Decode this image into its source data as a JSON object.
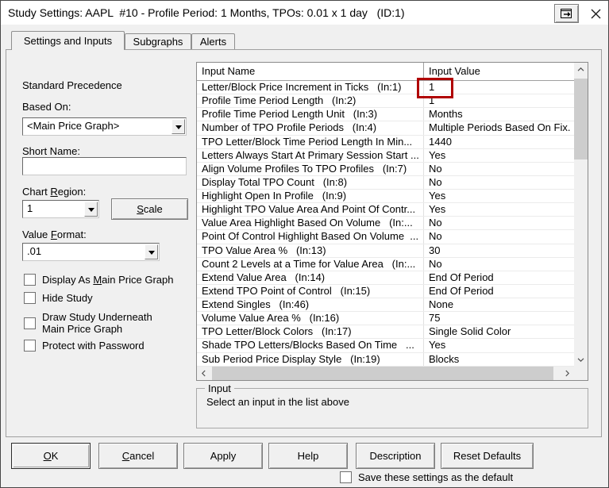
{
  "window": {
    "title": "Study Settings: AAPL  #10 - Profile Period: 1 Months, TPOs: 0.01 x 1 day   (ID:1)"
  },
  "tabs": [
    {
      "label": "Settings and Inputs",
      "active": true
    },
    {
      "label": "Subgraphs",
      "active": false
    },
    {
      "label": "Alerts",
      "active": false
    }
  ],
  "left_panel": {
    "precedence_text": "Standard Precedence",
    "based_on_label": "Based On:",
    "based_on_value": "<Main Price Graph>",
    "short_name_label": "Short Name:",
    "short_name_value": "",
    "chart_region_label": {
      "pre": "Chart ",
      "u": "R",
      "post": "egion:"
    },
    "chart_region_value": "1",
    "scale_button": {
      "pre": "",
      "u": "S",
      "post": "cale"
    },
    "value_format_label": {
      "pre": "Value ",
      "u": "F",
      "post": "ormat:"
    },
    "value_format_value": ".01",
    "checkboxes": [
      {
        "pre": "Display As ",
        "u": "M",
        "post": "ain Price Graph",
        "checked": false
      },
      {
        "pre": "Hide Study",
        "u": "",
        "post": "",
        "checked": false
      },
      {
        "pre": "Draw Study Underneath\nMain Price Graph",
        "u": "",
        "post": "",
        "checked": false
      },
      {
        "pre": "Protect with Password",
        "u": "",
        "post": "",
        "checked": false
      }
    ]
  },
  "inputs_table": {
    "columns": [
      "Input Name",
      "Input Value"
    ],
    "rows": [
      {
        "name": "Letter/Block Price Increment in Ticks   (In:1)",
        "value": "1"
      },
      {
        "name": "Profile Time Period Length   (In:2)",
        "value": "1"
      },
      {
        "name": "Profile Time Period Length Unit   (In:3)",
        "value": "Months"
      },
      {
        "name": "Number of TPO Profile Periods   (In:4)",
        "value": "Multiple Periods Based On Fix."
      },
      {
        "name": "TPO Letter/Block Time Period Length In Min...",
        "value": "1440"
      },
      {
        "name": "Letters Always Start At Primary Session Start ...",
        "value": "Yes"
      },
      {
        "name": "Align Volume Profiles To TPO Profiles   (In:7)",
        "value": "No"
      },
      {
        "name": "Display Total TPO Count   (In:8)",
        "value": "No"
      },
      {
        "name": "Highlight Open In Profile   (In:9)",
        "value": "Yes"
      },
      {
        "name": "Highlight TPO Value Area And Point Of Contr...",
        "value": "Yes"
      },
      {
        "name": "Value Area Highlight Based On Volume   (In:...",
        "value": "No"
      },
      {
        "name": "Point Of Control Highlight Based On Volume  ...",
        "value": "No"
      },
      {
        "name": "TPO Value Area %   (In:13)",
        "value": "30"
      },
      {
        "name": "Count 2 Levels at a Time for Value Area   (In:...",
        "value": "No"
      },
      {
        "name": "Extend Value Area   (In:14)",
        "value": "End Of Period"
      },
      {
        "name": "Extend TPO Point of Control   (In:15)",
        "value": "End Of Period"
      },
      {
        "name": "Extend Singles   (In:46)",
        "value": "None"
      },
      {
        "name": "Volume Value Area %   (In:16)",
        "value": "75"
      },
      {
        "name": "TPO Letter/Block Colors   (In:17)",
        "value": "Single Solid Color"
      },
      {
        "name": "Shade TPO Letters/Blocks Based On Time   ...",
        "value": "Yes"
      },
      {
        "name": "Sub Period Price Display Style   (In:19)",
        "value": "Blocks"
      }
    ],
    "annotation": {
      "row": 0,
      "column": "Input Value",
      "color": "#b00000"
    }
  },
  "input_group": {
    "legend": "Input",
    "message": "Select an input in the list above"
  },
  "footer": {
    "buttons": [
      {
        "pre": "",
        "u": "O",
        "post": "K",
        "default": true
      },
      {
        "pre": "",
        "u": "C",
        "post": "ancel",
        "default": false
      },
      {
        "pre": "Apply",
        "u": "",
        "post": "",
        "default": false
      },
      {
        "pre": "Help",
        "u": "",
        "post": "",
        "default": false
      },
      {
        "pre": "Description",
        "u": "",
        "post": "",
        "default": false
      },
      {
        "pre": "Reset Defaults",
        "u": "",
        "post": "",
        "default": false
      }
    ],
    "save_default": {
      "label": "Save these settings as the default",
      "checked": false
    }
  },
  "icons": {
    "titlebar": [
      "pop-out-icon",
      "close-icon"
    ],
    "scrollbar": [
      "chevron-up-icon",
      "chevron-down-icon",
      "chevron-left-icon",
      "chevron-right-icon"
    ],
    "combo": "down-arrow-icon"
  },
  "colors": {
    "dialog_bg": "#f0f0f0",
    "titlebar_bg": "#ffffff",
    "annotation_red": "#b00000",
    "scroll_thumb": "#cdcdcd"
  }
}
